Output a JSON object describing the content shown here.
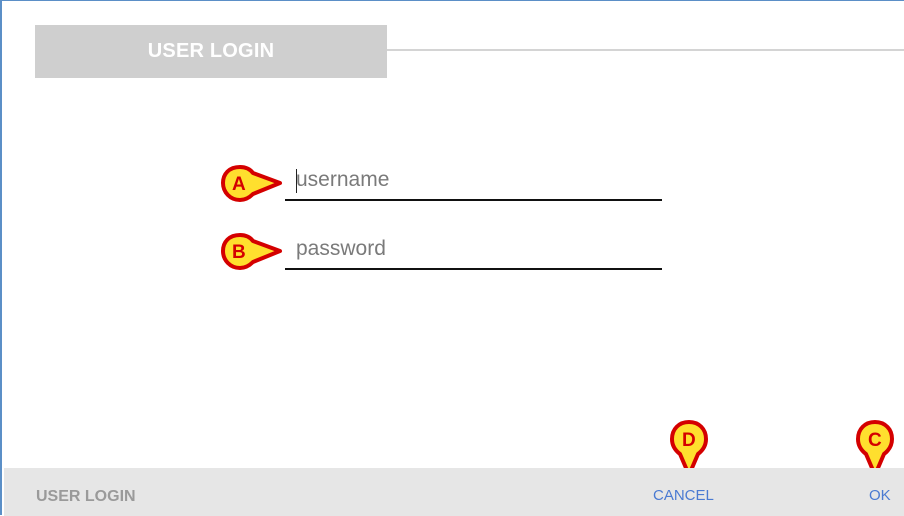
{
  "header": {
    "title": "USER LOGIN"
  },
  "form": {
    "username": {
      "value": "",
      "placeholder": "username"
    },
    "password": {
      "value": "",
      "placeholder": "password"
    }
  },
  "footer": {
    "title": "USER LOGIN",
    "cancel_label": "CANCEL",
    "ok_label": "OK"
  },
  "callouts": [
    {
      "letter": "A",
      "target": "username-field"
    },
    {
      "letter": "B",
      "target": "password-field"
    },
    {
      "letter": "C",
      "target": "ok-button"
    },
    {
      "letter": "D",
      "target": "cancel-button"
    }
  ],
  "colors": {
    "accent": "#4a7ad2",
    "frame": "#5b8fc7",
    "callout_fill": "#ffdf2e",
    "callout_stroke": "#d40000"
  }
}
